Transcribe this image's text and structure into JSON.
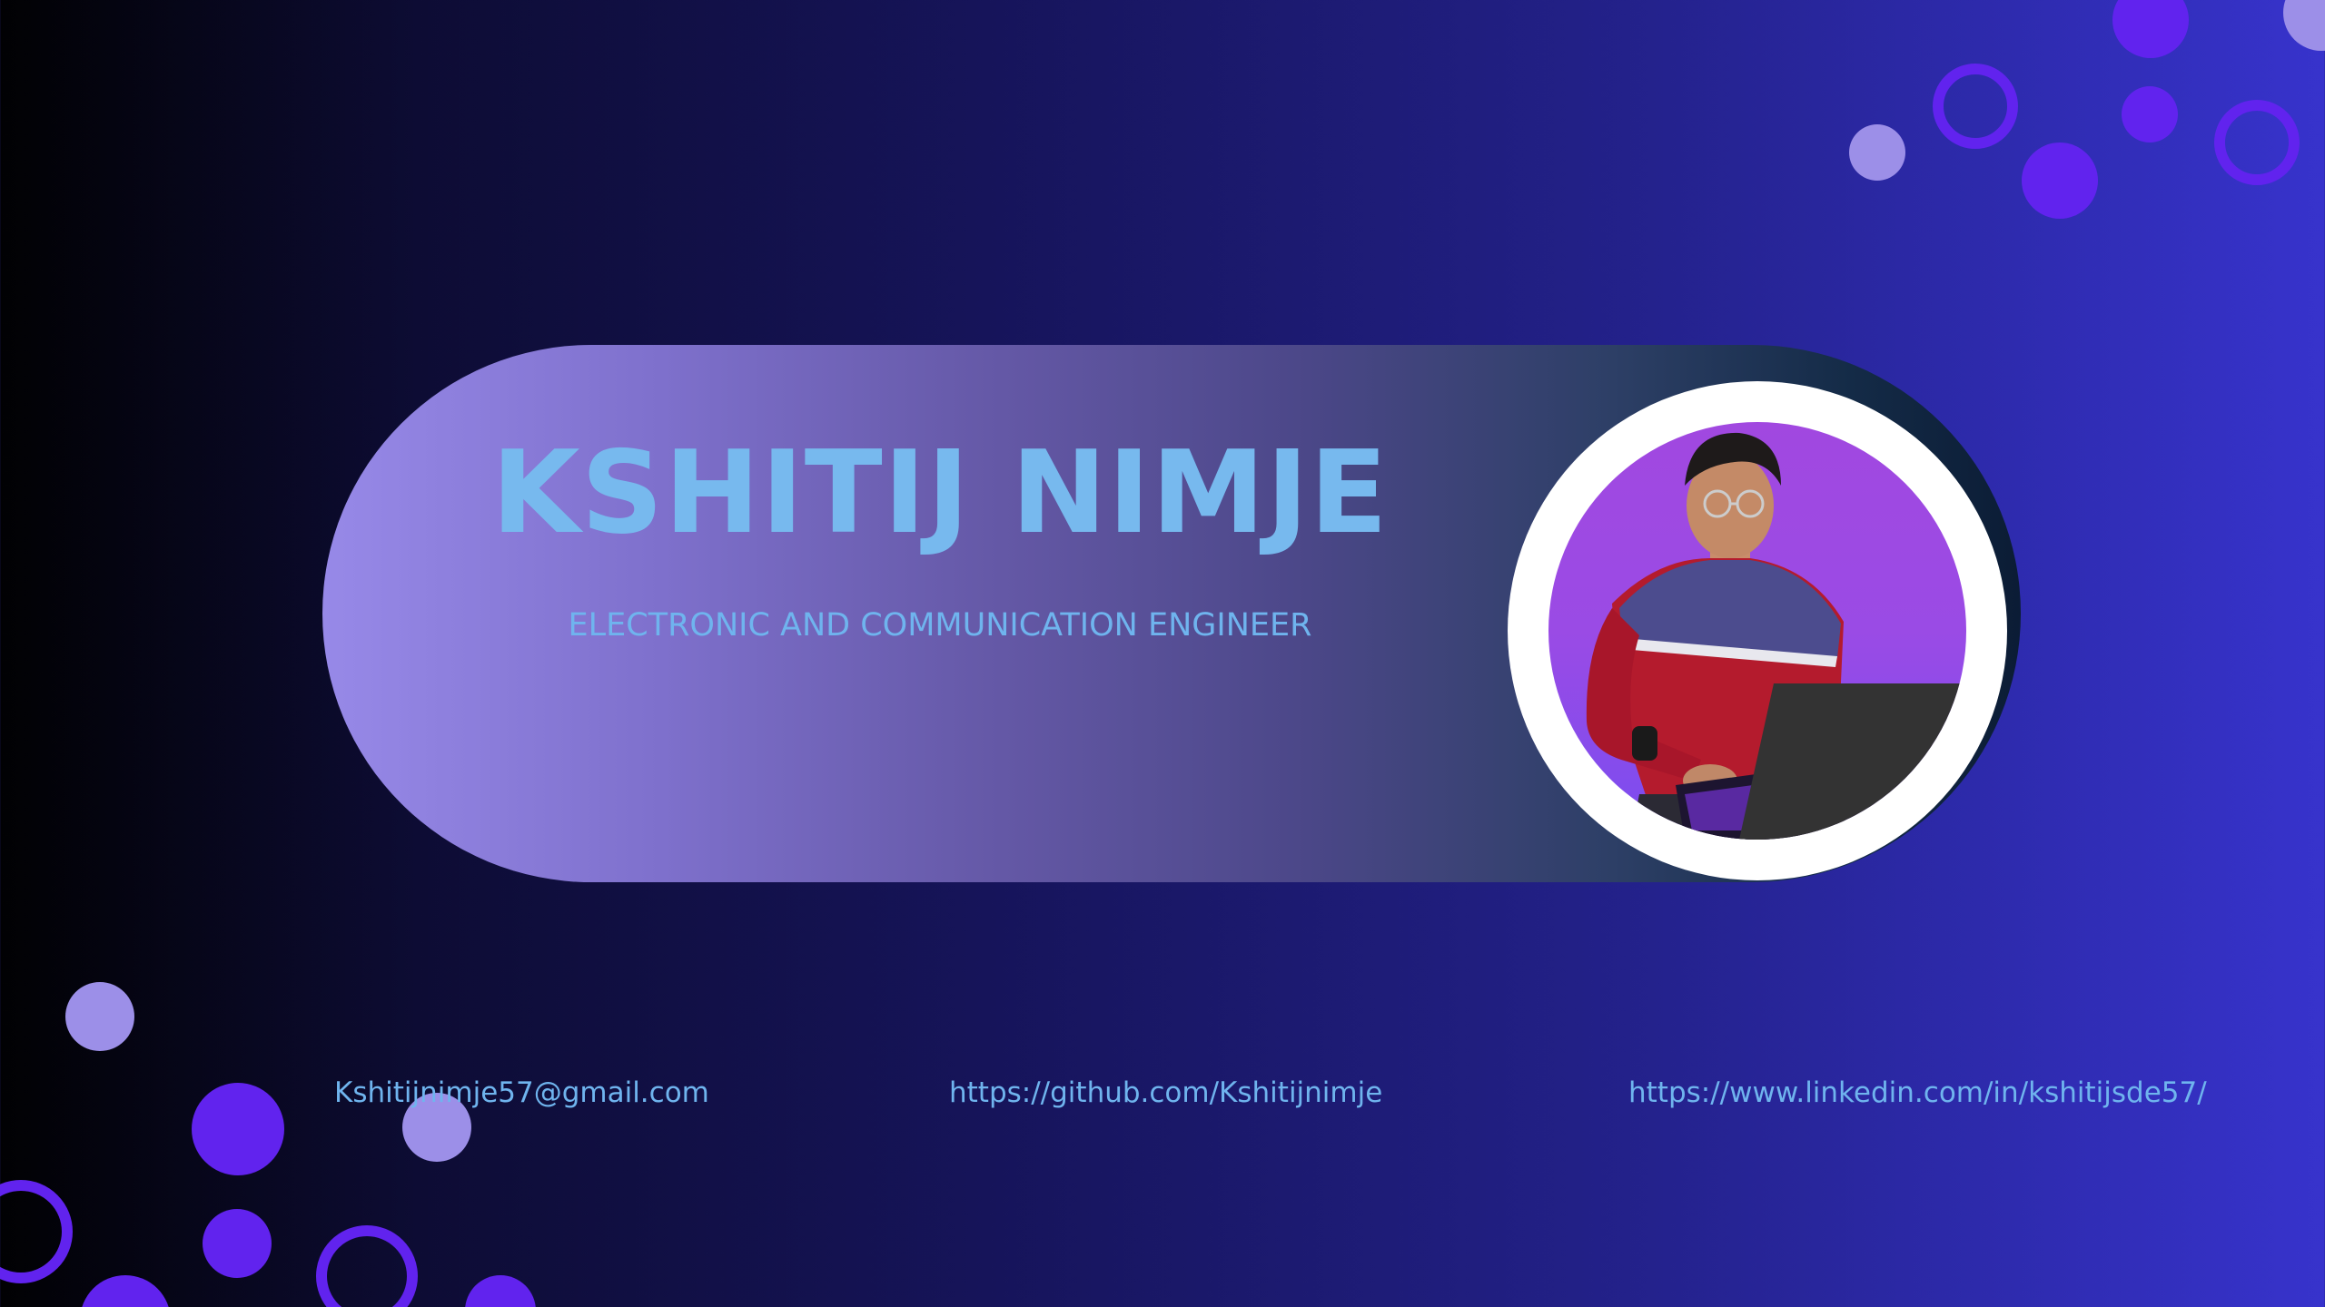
{
  "profile": {
    "name": "KSHITIJ NIMJE",
    "role": "ELECTRONIC AND COMMUNICATION ENGINEER",
    "photo_alt": "person-working-on-laptop-photo"
  },
  "contacts": {
    "email": "Kshitijnimje57@gmail.com",
    "github": "https://github.com/Kshitijnimje",
    "linkedin": "https://www.linkedin.com/in/kshitijsde57/"
  },
  "colors": {
    "background_dark": "#010103",
    "background_light": "#3733cc",
    "accent_text": "#77b9ee",
    "lavender_dot": "#9c8fe8",
    "violet_dot": "#6123ee",
    "photo_bg": "#a148e0"
  }
}
